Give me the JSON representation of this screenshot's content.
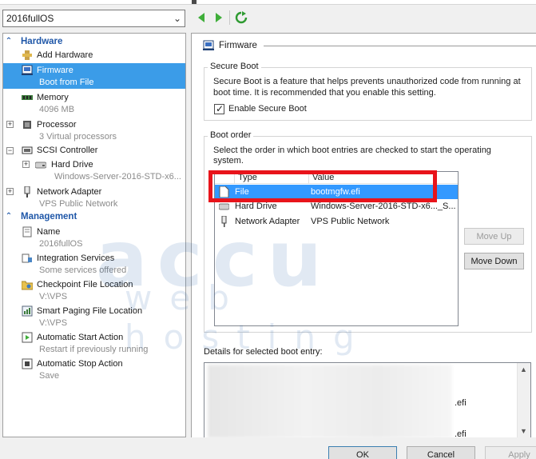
{
  "vm_selector": {
    "value": "2016fullOS"
  },
  "sidebar": {
    "hardware_header": "Hardware",
    "management_header": "Management",
    "hardware_items": [
      {
        "label": "Add Hardware",
        "sub": ""
      },
      {
        "label": "Firmware",
        "sub": "Boot from File"
      },
      {
        "label": "Memory",
        "sub": "4096 MB"
      },
      {
        "label": "Processor",
        "sub": "3 Virtual processors"
      },
      {
        "label": "SCSI Controller",
        "sub": ""
      },
      {
        "label": "Hard Drive",
        "sub": "Windows-Server-2016-STD-x6..."
      },
      {
        "label": "Network Adapter",
        "sub": "VPS Public Network"
      }
    ],
    "management_items": [
      {
        "label": "Name",
        "sub": "2016fullOS"
      },
      {
        "label": "Integration Services",
        "sub": "Some services offered"
      },
      {
        "label": "Checkpoint File Location",
        "sub": "V:\\VPS"
      },
      {
        "label": "Smart Paging File Location",
        "sub": "V:\\VPS"
      },
      {
        "label": "Automatic Start Action",
        "sub": "Restart if previously running"
      },
      {
        "label": "Automatic Stop Action",
        "sub": "Save"
      }
    ]
  },
  "firmware": {
    "title": "Firmware",
    "secure_boot": {
      "label": "Secure Boot",
      "description_1": "Secure Boot is a feature that helps prevents unauthorized code from running at",
      "description_2": "boot time. It is recommended that you enable this setting.",
      "checkbox_label": "Enable Secure Boot",
      "checked": true
    },
    "boot_order": {
      "label": "Boot order",
      "description_1": "Select the order in which boot entries are checked to start the operating",
      "description_2": "system.",
      "columns": [
        "Type",
        "Value"
      ],
      "entries": [
        {
          "type": "File",
          "value": "bootmgfw.efi"
        },
        {
          "type": "Hard Drive",
          "value": "Windows-Server-2016-STD-x6..._S..."
        },
        {
          "type": "Network Adapter",
          "value": "VPS Public Network"
        }
      ],
      "move_up": "Move Up",
      "move_down": "Move Down"
    },
    "details": {
      "label": "Details for selected boot entry:",
      "fragment_1": ".efi",
      "fragment_2": ".efi"
    }
  },
  "watermark": {
    "line1": "accu",
    "line2": "web hosting"
  },
  "footer": {
    "ok": "OK",
    "cancel": "Cancel",
    "apply": "Apply"
  },
  "colors": {
    "selection": "#3b9ce8",
    "highlight_box": "#e8141b",
    "section_header": "#1f57a8"
  }
}
